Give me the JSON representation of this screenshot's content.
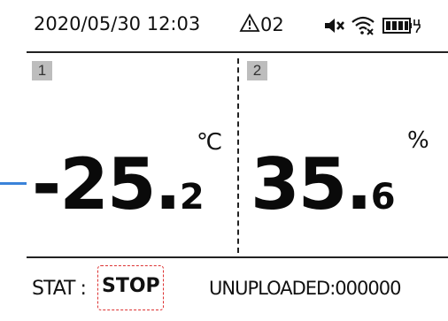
{
  "status_bar": {
    "datetime": "2020/05/30 12:03",
    "alarm_count": "02",
    "icons": [
      "alarm-icon",
      "mute-icon",
      "wifi-off-icon",
      "battery-icon"
    ]
  },
  "channels": [
    {
      "label": "1",
      "value_int": "-25.",
      "value_dec": "2",
      "unit": "℃"
    },
    {
      "label": "2",
      "value_int": "35.",
      "value_dec": "6",
      "unit": "%"
    }
  ],
  "bottom_bar": {
    "stat_label": "STAT :",
    "stat_value": "STOP",
    "unuploaded": "UNUPLOADED:000000"
  },
  "colors": {
    "marker": "#3a83d9",
    "highlight_border": "#dd3333",
    "label_bg": "#bdbdbd"
  }
}
